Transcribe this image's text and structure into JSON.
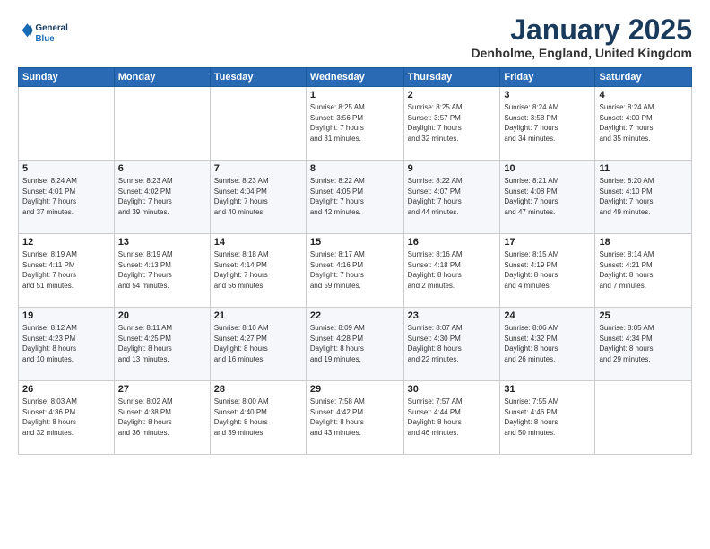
{
  "header": {
    "logo_line1": "General",
    "logo_line2": "Blue",
    "month": "January 2025",
    "location": "Denholme, England, United Kingdom"
  },
  "days_of_week": [
    "Sunday",
    "Monday",
    "Tuesday",
    "Wednesday",
    "Thursday",
    "Friday",
    "Saturday"
  ],
  "weeks": [
    [
      {
        "day": "",
        "info": ""
      },
      {
        "day": "",
        "info": ""
      },
      {
        "day": "",
        "info": ""
      },
      {
        "day": "1",
        "info": "Sunrise: 8:25 AM\nSunset: 3:56 PM\nDaylight: 7 hours\nand 31 minutes."
      },
      {
        "day": "2",
        "info": "Sunrise: 8:25 AM\nSunset: 3:57 PM\nDaylight: 7 hours\nand 32 minutes."
      },
      {
        "day": "3",
        "info": "Sunrise: 8:24 AM\nSunset: 3:58 PM\nDaylight: 7 hours\nand 34 minutes."
      },
      {
        "day": "4",
        "info": "Sunrise: 8:24 AM\nSunset: 4:00 PM\nDaylight: 7 hours\nand 35 minutes."
      }
    ],
    [
      {
        "day": "5",
        "info": "Sunrise: 8:24 AM\nSunset: 4:01 PM\nDaylight: 7 hours\nand 37 minutes."
      },
      {
        "day": "6",
        "info": "Sunrise: 8:23 AM\nSunset: 4:02 PM\nDaylight: 7 hours\nand 39 minutes."
      },
      {
        "day": "7",
        "info": "Sunrise: 8:23 AM\nSunset: 4:04 PM\nDaylight: 7 hours\nand 40 minutes."
      },
      {
        "day": "8",
        "info": "Sunrise: 8:22 AM\nSunset: 4:05 PM\nDaylight: 7 hours\nand 42 minutes."
      },
      {
        "day": "9",
        "info": "Sunrise: 8:22 AM\nSunset: 4:07 PM\nDaylight: 7 hours\nand 44 minutes."
      },
      {
        "day": "10",
        "info": "Sunrise: 8:21 AM\nSunset: 4:08 PM\nDaylight: 7 hours\nand 47 minutes."
      },
      {
        "day": "11",
        "info": "Sunrise: 8:20 AM\nSunset: 4:10 PM\nDaylight: 7 hours\nand 49 minutes."
      }
    ],
    [
      {
        "day": "12",
        "info": "Sunrise: 8:19 AM\nSunset: 4:11 PM\nDaylight: 7 hours\nand 51 minutes."
      },
      {
        "day": "13",
        "info": "Sunrise: 8:19 AM\nSunset: 4:13 PM\nDaylight: 7 hours\nand 54 minutes."
      },
      {
        "day": "14",
        "info": "Sunrise: 8:18 AM\nSunset: 4:14 PM\nDaylight: 7 hours\nand 56 minutes."
      },
      {
        "day": "15",
        "info": "Sunrise: 8:17 AM\nSunset: 4:16 PM\nDaylight: 7 hours\nand 59 minutes."
      },
      {
        "day": "16",
        "info": "Sunrise: 8:16 AM\nSunset: 4:18 PM\nDaylight: 8 hours\nand 2 minutes."
      },
      {
        "day": "17",
        "info": "Sunrise: 8:15 AM\nSunset: 4:19 PM\nDaylight: 8 hours\nand 4 minutes."
      },
      {
        "day": "18",
        "info": "Sunrise: 8:14 AM\nSunset: 4:21 PM\nDaylight: 8 hours\nand 7 minutes."
      }
    ],
    [
      {
        "day": "19",
        "info": "Sunrise: 8:12 AM\nSunset: 4:23 PM\nDaylight: 8 hours\nand 10 minutes."
      },
      {
        "day": "20",
        "info": "Sunrise: 8:11 AM\nSunset: 4:25 PM\nDaylight: 8 hours\nand 13 minutes."
      },
      {
        "day": "21",
        "info": "Sunrise: 8:10 AM\nSunset: 4:27 PM\nDaylight: 8 hours\nand 16 minutes."
      },
      {
        "day": "22",
        "info": "Sunrise: 8:09 AM\nSunset: 4:28 PM\nDaylight: 8 hours\nand 19 minutes."
      },
      {
        "day": "23",
        "info": "Sunrise: 8:07 AM\nSunset: 4:30 PM\nDaylight: 8 hours\nand 22 minutes."
      },
      {
        "day": "24",
        "info": "Sunrise: 8:06 AM\nSunset: 4:32 PM\nDaylight: 8 hours\nand 26 minutes."
      },
      {
        "day": "25",
        "info": "Sunrise: 8:05 AM\nSunset: 4:34 PM\nDaylight: 8 hours\nand 29 minutes."
      }
    ],
    [
      {
        "day": "26",
        "info": "Sunrise: 8:03 AM\nSunset: 4:36 PM\nDaylight: 8 hours\nand 32 minutes."
      },
      {
        "day": "27",
        "info": "Sunrise: 8:02 AM\nSunset: 4:38 PM\nDaylight: 8 hours\nand 36 minutes."
      },
      {
        "day": "28",
        "info": "Sunrise: 8:00 AM\nSunset: 4:40 PM\nDaylight: 8 hours\nand 39 minutes."
      },
      {
        "day": "29",
        "info": "Sunrise: 7:58 AM\nSunset: 4:42 PM\nDaylight: 8 hours\nand 43 minutes."
      },
      {
        "day": "30",
        "info": "Sunrise: 7:57 AM\nSunset: 4:44 PM\nDaylight: 8 hours\nand 46 minutes."
      },
      {
        "day": "31",
        "info": "Sunrise: 7:55 AM\nSunset: 4:46 PM\nDaylight: 8 hours\nand 50 minutes."
      },
      {
        "day": "",
        "info": ""
      }
    ]
  ]
}
